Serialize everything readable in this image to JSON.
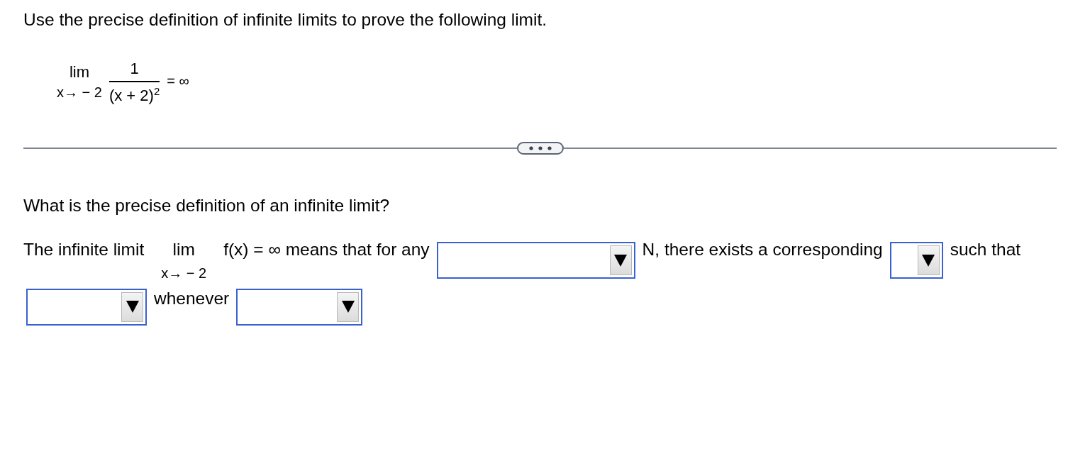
{
  "prompt": "Use the precise definition of infinite limits to prove the following limit.",
  "limit_expression": {
    "operator": "lim",
    "approach": "x→ − 2",
    "numerator": "1",
    "denominator": "(x + 2)$^{2}$",
    "result": "= ∞"
  },
  "question": "What is the precise definition of an infinite limit?",
  "answer_lines": [
    [
      {
        "kind": "text",
        "text": "The infinite limit"
      },
      {
        "kind": "limit",
        "operator": "lim",
        "approach": "x→ − 2"
      },
      {
        "kind": "text",
        "text": "f(x) = ∞ means that for any"
      },
      {
        "kind": "dropdown"
      },
      {
        "kind": "text",
        "text": "N, there exists a corresponding"
      },
      {
        "kind": "dropdown"
      },
      {
        "kind": "text",
        "text": "such that"
      }
    ],
    [
      {
        "kind": "dropdown"
      },
      {
        "kind": "text",
        "text": "whenever"
      },
      {
        "kind": "dropdown"
      }
    ]
  ]
}
